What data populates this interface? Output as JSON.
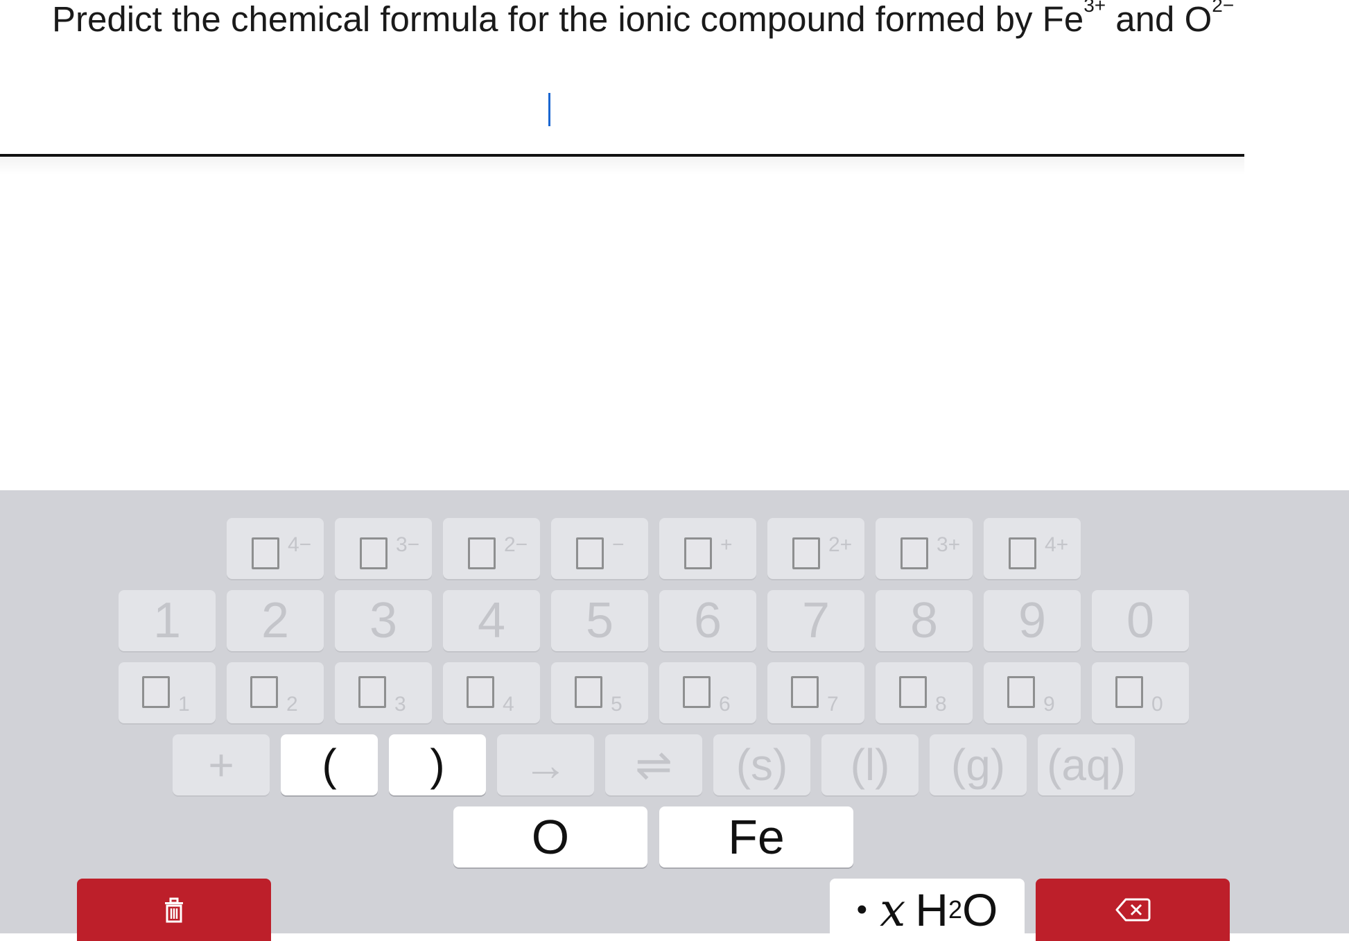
{
  "question": {
    "text": "Predict the chemical formula for the ionic compound formed by Fe",
    "cation_charge": "3+",
    "connector": " and O",
    "anion_charge": "2−"
  },
  "answer": {
    "value": ""
  },
  "keyboard": {
    "charge_keys": [
      "4−",
      "3−",
      "2−",
      "−",
      "+",
      "2+",
      "3+",
      "4+"
    ],
    "number_keys": [
      "1",
      "2",
      "3",
      "4",
      "5",
      "6",
      "7",
      "8",
      "9",
      "0"
    ],
    "subscript_keys": [
      "1",
      "2",
      "3",
      "4",
      "5",
      "6",
      "7",
      "8",
      "9",
      "0"
    ],
    "symbols": {
      "plus": "+",
      "open_paren": "(",
      "close_paren": ")",
      "arrow": "→",
      "equilibrium": "⇌",
      "solid": "(s)",
      "liquid": "(l)",
      "gas": "(g)",
      "aqueous": "(aq)"
    },
    "elements": [
      "O",
      "Fe"
    ],
    "hydrate": {
      "dot": "•",
      "x": "x",
      "h": "H",
      "sub": "2",
      "o": "O"
    },
    "icons": {
      "clear": "trash-icon",
      "backspace": "backspace-icon"
    },
    "colors": {
      "accent_red": "#bd1f2a",
      "caret_blue": "#1a66d0",
      "keyboard_bg": "#d1d2d7"
    }
  }
}
